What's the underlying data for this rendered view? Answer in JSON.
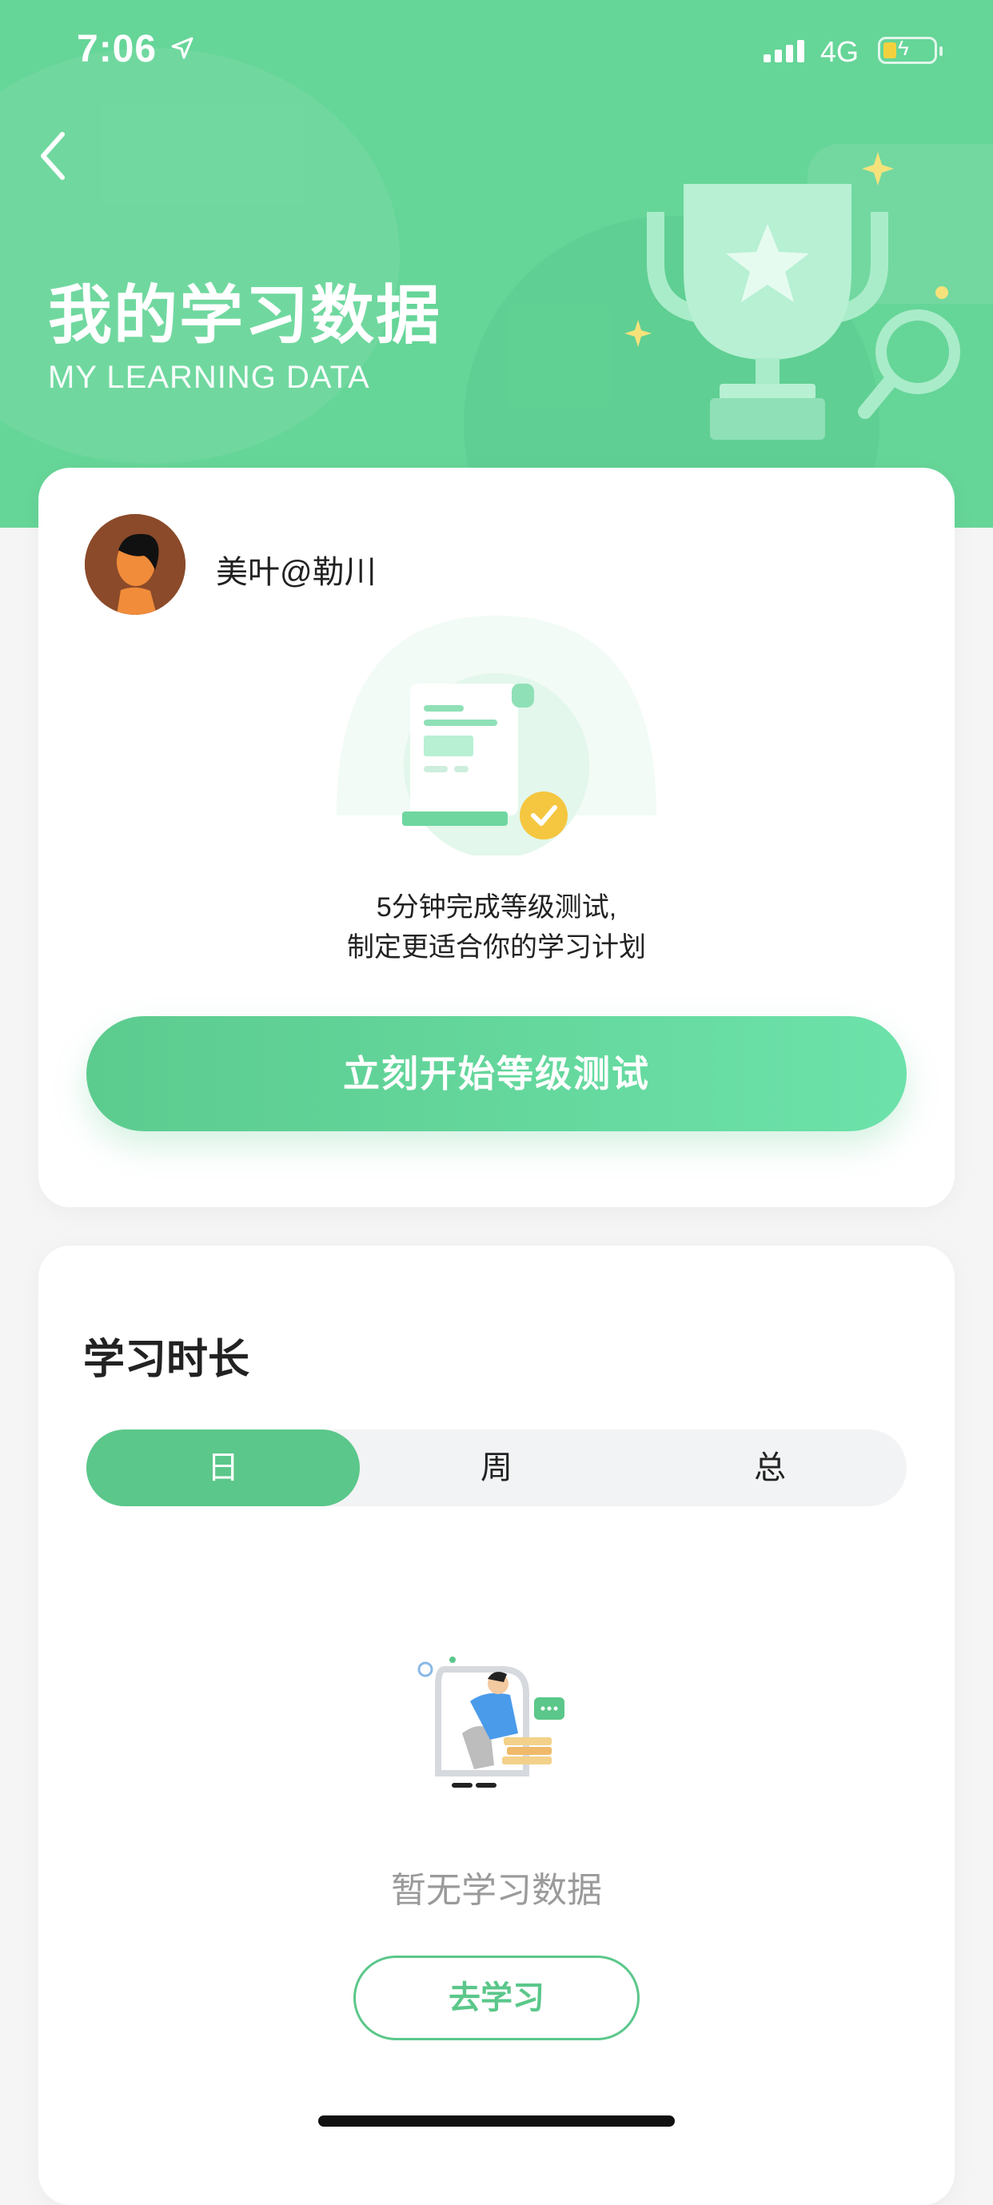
{
  "status_bar": {
    "time": "7:06",
    "network": "4G"
  },
  "header": {
    "title": "我的学习数据",
    "subtitle": "MY LEARNING DATA"
  },
  "profile": {
    "username": "美叶@勒川"
  },
  "level_test": {
    "tip_line1": "5分钟完成等级测试,",
    "tip_line2": "制定更适合你的学习计划",
    "start_button": "立刻开始等级测试"
  },
  "study_time": {
    "title": "学习时长",
    "tabs": [
      {
        "label": "日",
        "active": true
      },
      {
        "label": "周",
        "active": false
      },
      {
        "label": "总",
        "active": false
      }
    ],
    "empty_text": "暂无学习数据",
    "go_button": "去学习"
  },
  "colors": {
    "accent": "#5bc78a",
    "header_bg": "#66d598",
    "badge": "#f5c640"
  },
  "icons": [
    "location-arrow-icon",
    "signal-icon",
    "battery-icon",
    "back-chevron-icon",
    "trophy-icon",
    "magnifier-icon",
    "document-check-icon"
  ]
}
